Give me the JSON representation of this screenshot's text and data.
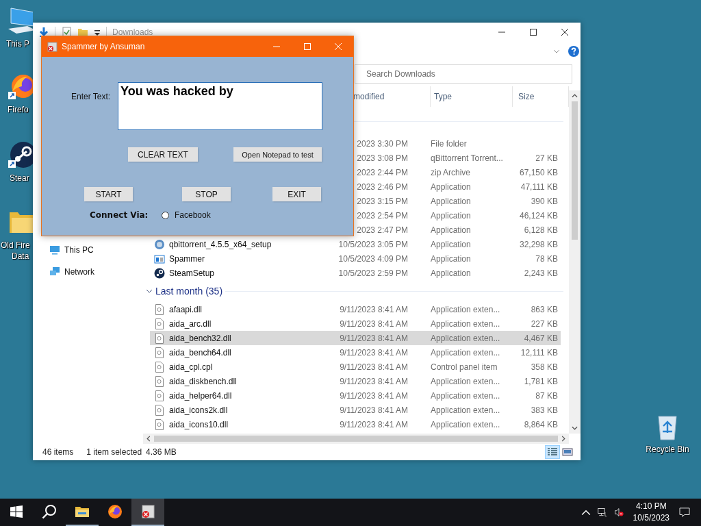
{
  "desktop": {
    "icons": [
      {
        "kind": "computer",
        "label_lines": [
          "This P"
        ]
      },
      {
        "kind": "firefox",
        "label_lines": [
          "Firefo"
        ]
      },
      {
        "kind": "steam",
        "label_lines": [
          "Stear"
        ]
      },
      {
        "kind": "folder",
        "label_lines": [
          "Old Fire",
          "Data"
        ]
      },
      {
        "kind": "recycle",
        "label_lines": [
          "Recycle Bin"
        ]
      }
    ]
  },
  "explorer": {
    "title": "Downloads",
    "search": {
      "placeholder": "Search Downloads"
    },
    "columns": [
      "modified",
      "Type",
      "Size"
    ],
    "nav_items": [
      {
        "kind": "computer",
        "label": "This PC",
        "selected": false
      },
      {
        "kind": "network",
        "label": "Network",
        "selected": false
      }
    ],
    "groups": [
      {
        "rows": [
          {
            "kind": "hidden",
            "date": "2023 3:30 PM",
            "type": "File folder",
            "selected": false
          },
          {
            "kind": "hidden",
            "date": "2023 3:08 PM",
            "type": "qBittorrent Torrent...",
            "size": "27 KB",
            "selected": false
          },
          {
            "kind": "hidden",
            "date": "2023 2:44 PM",
            "type": "zip Archive",
            "size": "67,150 KB",
            "selected": false
          },
          {
            "kind": "hidden",
            "date": "2023 2:46 PM",
            "type": "Application",
            "size": "47,111 KB",
            "selected": false
          },
          {
            "kind": "hidden",
            "date": "2023 3:15 PM",
            "type": "Application",
            "size": "390 KB",
            "selected": false
          },
          {
            "kind": "hidden",
            "date": "2023 2:54 PM",
            "type": "Application",
            "size": "46,124 KB",
            "selected": false
          },
          {
            "kind": "hidden",
            "date": "2023 2:47 PM",
            "type": "Application",
            "size": "6,128 KB",
            "selected": false
          },
          {
            "kind": "setup",
            "name": "qbittorrent_4.5.5_x64_setup",
            "date": "10/5/2023 3:05 PM",
            "type": "Application",
            "size": "32,298 KB",
            "selected": false
          },
          {
            "kind": "app",
            "name": "Spammer",
            "date": "10/5/2023 4:09 PM",
            "type": "Application",
            "size": "78 KB",
            "selected": false
          },
          {
            "kind": "steam",
            "name": "SteamSetup",
            "date": "10/5/2023 2:59 PM",
            "type": "Application",
            "size": "2,243 KB",
            "selected": false
          }
        ]
      },
      {
        "title": "Last month (35)",
        "expanded": true,
        "rows": [
          {
            "kind": "dll",
            "name": "afaapi.dll",
            "date": "9/11/2023 8:41 AM",
            "type": "Application exten...",
            "size": "863 KB",
            "selected": false
          },
          {
            "kind": "dll",
            "name": "aida_arc.dll",
            "date": "9/11/2023 8:41 AM",
            "type": "Application exten...",
            "size": "227 KB",
            "selected": false
          },
          {
            "kind": "dll",
            "name": "aida_bench32.dll",
            "date": "9/11/2023 8:41 AM",
            "type": "Application exten...",
            "size": "4,467 KB",
            "selected": true
          },
          {
            "kind": "dll",
            "name": "aida_bench64.dll",
            "date": "9/11/2023 8:41 AM",
            "type": "Application exten...",
            "size": "12,111 KB",
            "selected": false
          },
          {
            "kind": "dll",
            "name": "aida_cpl.cpl",
            "date": "9/11/2023 8:41 AM",
            "type": "Control panel item",
            "size": "358 KB",
            "selected": false
          },
          {
            "kind": "dll",
            "name": "aida_diskbench.dll",
            "date": "9/11/2023 8:41 AM",
            "type": "Application exten...",
            "size": "1,781 KB",
            "selected": false
          },
          {
            "kind": "dll",
            "name": "aida_helper64.dll",
            "date": "9/11/2023 8:41 AM",
            "type": "Application exten...",
            "size": "87 KB",
            "selected": false
          },
          {
            "kind": "dll",
            "name": "aida_icons2k.dll",
            "date": "9/11/2023 8:41 AM",
            "type": "Application exten...",
            "size": "383 KB",
            "selected": false
          },
          {
            "kind": "dll",
            "name": "aida_icons10.dll",
            "date": "9/11/2023 8:41 AM",
            "type": "Application exten...",
            "size": "8,864 KB",
            "selected": false
          }
        ]
      }
    ],
    "status": {
      "count": "46 items",
      "selection": "1 item selected",
      "size": "4.36 MB"
    },
    "views": [
      {
        "kind": "details",
        "selected": true
      },
      {
        "kind": "large",
        "selected": false
      }
    ]
  },
  "spammer": {
    "title": "Spammer by Ansuman",
    "text_label": "Enter Text:",
    "text_value": "You was hacked by",
    "buttons_top": [
      "CLEAR TEXT",
      "Open Notepad to test"
    ],
    "buttons_bottom": [
      "START",
      "STOP",
      "EXIT"
    ],
    "connect_label": "Connect Via:",
    "radio": {
      "label": "Facebook",
      "checked": false
    }
  },
  "taskbar": {
    "items": [
      {
        "kind": "start",
        "running": false,
        "selected": false
      },
      {
        "kind": "search",
        "running": false,
        "selected": false
      },
      {
        "kind": "explorer",
        "running": true,
        "selected": false
      },
      {
        "kind": "firefox",
        "running": false,
        "selected": false
      },
      {
        "kind": "spammer",
        "running": true,
        "selected": true
      }
    ],
    "time": "4:10 PM",
    "date": "10/5/2023",
    "volume_muted": true
  }
}
